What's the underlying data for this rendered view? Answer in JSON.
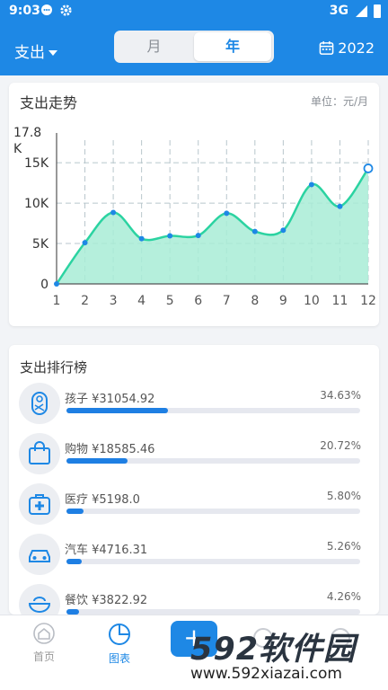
{
  "status_bar": {
    "time": "9:03",
    "network": "3G"
  },
  "app_bar": {
    "type_label": "支出",
    "segment_month": "月",
    "segment_year": "年",
    "year": "2022"
  },
  "trend_card": {
    "title": "支出走势",
    "unit": "单位：元/月",
    "y_top_label": "17.8K"
  },
  "chart_data": {
    "type": "area",
    "x": [
      1,
      2,
      3,
      4,
      5,
      6,
      7,
      8,
      9,
      10,
      11,
      12
    ],
    "series": [
      {
        "values": [
          0,
          5100,
          8850,
          5600,
          5950,
          6000,
          8750,
          6500,
          6650,
          12300,
          9600,
          14300
        ]
      }
    ],
    "x_ticks": [
      "1",
      "2",
      "3",
      "4",
      "5",
      "6",
      "7",
      "8",
      "9",
      "10",
      "11",
      "12"
    ],
    "y_ticks": [
      "0",
      "5K",
      "10K",
      "15K",
      "17.8K"
    ],
    "ylim": [
      0,
      17800
    ],
    "grid": true,
    "colors": {
      "line": "#2bd3a1",
      "fill": "#a8ecd6",
      "point": "#1e88e5"
    }
  },
  "ranking_card": {
    "title": "支出排行榜",
    "items": [
      {
        "name": "孩子",
        "amount": "¥31054.92",
        "label": "孩子 ¥31054.92",
        "pct": "34.63%",
        "fraction": 0.3463,
        "icon": "baby-icon"
      },
      {
        "name": "购物",
        "amount": "¥18585.46",
        "label": "购物 ¥18585.46",
        "pct": "20.72%",
        "fraction": 0.2072,
        "icon": "shopping-bag-icon"
      },
      {
        "name": "医疗",
        "amount": "¥5198.0",
        "label": "医疗 ¥5198.0",
        "pct": "5.80%",
        "fraction": 0.058,
        "icon": "medical-kit-icon"
      },
      {
        "name": "汽车",
        "amount": "¥4716.31",
        "label": "汽车 ¥4716.31",
        "pct": "5.26%",
        "fraction": 0.0526,
        "icon": "car-icon"
      },
      {
        "name": "餐饮",
        "amount": "¥3822.92",
        "label": "餐饮 ¥3822.92",
        "pct": "4.26%",
        "fraction": 0.0426,
        "icon": "food-bowl-icon"
      }
    ]
  },
  "bottom_nav": {
    "home": "首页",
    "chart": "图表"
  },
  "watermark": {
    "main": "592软件园",
    "url": "www.592xiazai.com"
  },
  "colors": {
    "primary": "#1e88e5"
  }
}
